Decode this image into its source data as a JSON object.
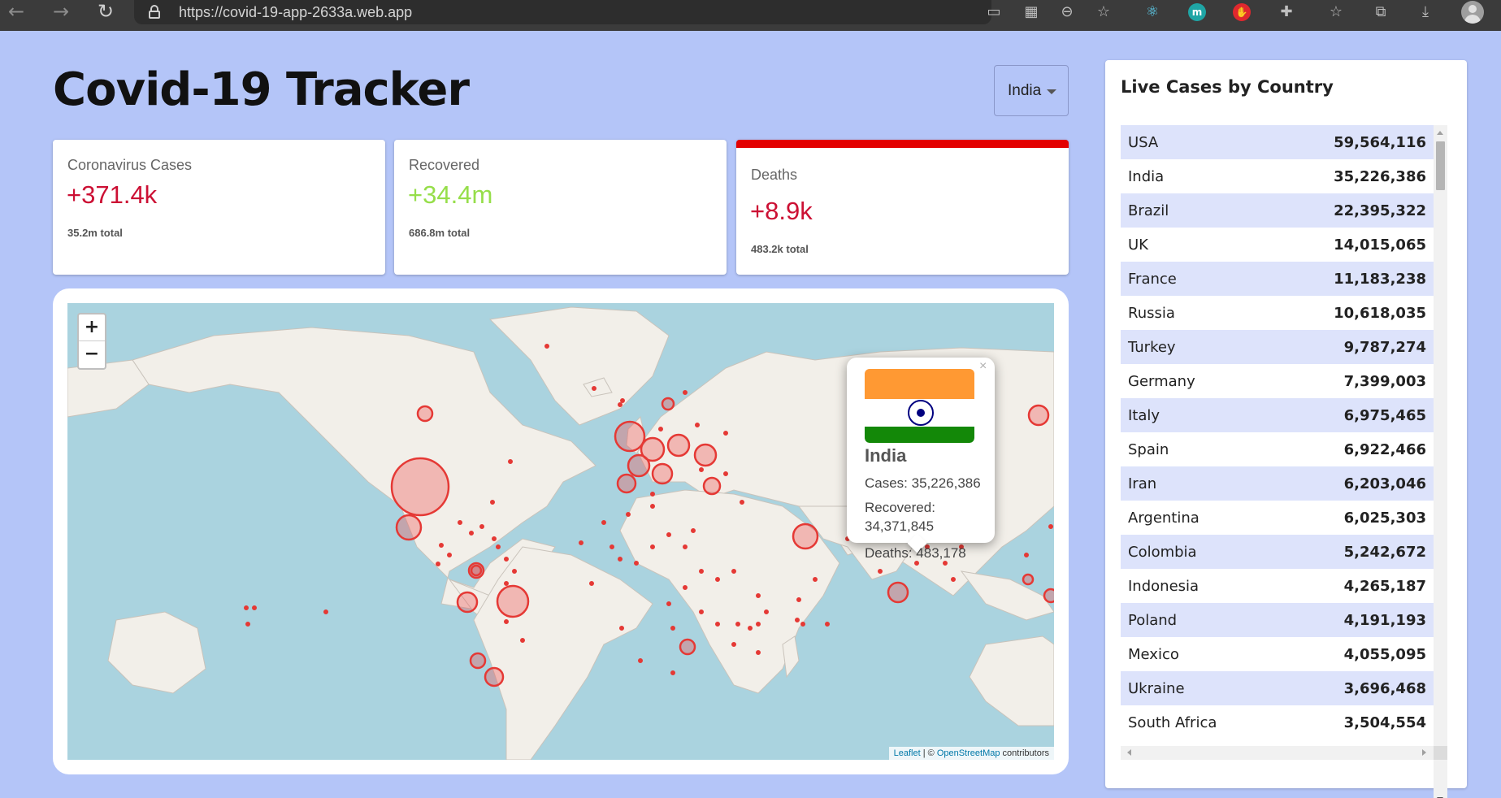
{
  "browser": {
    "url": "https://covid-19-app-2633a.web.app"
  },
  "header": {
    "title": "Covid-19 Tracker",
    "country_select": "India"
  },
  "cards": [
    {
      "label": "Coronavirus Cases",
      "value": "+371.4k",
      "total": "35.2m total",
      "selected": false
    },
    {
      "label": "Recovered",
      "value": "+34.4m",
      "total": "686.8m total",
      "selected": false
    },
    {
      "label": "Deaths",
      "value": "+8.9k",
      "total": "483.2k total",
      "selected": true
    }
  ],
  "map": {
    "zoom_in": "+",
    "zoom_out": "−",
    "attribution": {
      "leaflet": "Leaflet",
      "sep": " | © ",
      "osm": "OpenStreetMap",
      "suffix": " contributors"
    },
    "popup": {
      "country": "India",
      "cases": "Cases: 35,226,386",
      "recovered_label": "Recovered:",
      "recovered_value": "34,371,845",
      "deaths": "Deaths: 483,178",
      "close": "×"
    }
  },
  "live_cases": {
    "title": "Live Cases by Country",
    "rows": [
      {
        "country": "USA",
        "cases": "59,564,116"
      },
      {
        "country": "India",
        "cases": "35,226,386"
      },
      {
        "country": "Brazil",
        "cases": "22,395,322"
      },
      {
        "country": "UK",
        "cases": "14,015,065"
      },
      {
        "country": "France",
        "cases": "11,183,238"
      },
      {
        "country": "Russia",
        "cases": "10,618,035"
      },
      {
        "country": "Turkey",
        "cases": "9,787,274"
      },
      {
        "country": "Germany",
        "cases": "7,399,003"
      },
      {
        "country": "Italy",
        "cases": "6,975,465"
      },
      {
        "country": "Spain",
        "cases": "6,922,466"
      },
      {
        "country": "Iran",
        "cases": "6,203,046"
      },
      {
        "country": "Argentina",
        "cases": "6,025,303"
      },
      {
        "country": "Colombia",
        "cases": "5,242,672"
      },
      {
        "country": "Indonesia",
        "cases": "4,265,187"
      },
      {
        "country": "Poland",
        "cases": "4,191,193"
      },
      {
        "country": "Mexico",
        "cases": "4,055,095"
      },
      {
        "country": "Ukraine",
        "cases": "3,696,468"
      },
      {
        "country": "South Africa",
        "cases": "3,504,554"
      },
      {
        "country": "",
        "cases": ""
      }
    ]
  },
  "colors": {
    "page_bg": "#b4c5f8",
    "cases_red": "#cc1034",
    "recovered_green": "#7dd71d",
    "selected_border": "#e30000",
    "row_stripe": "#dde3fb"
  }
}
